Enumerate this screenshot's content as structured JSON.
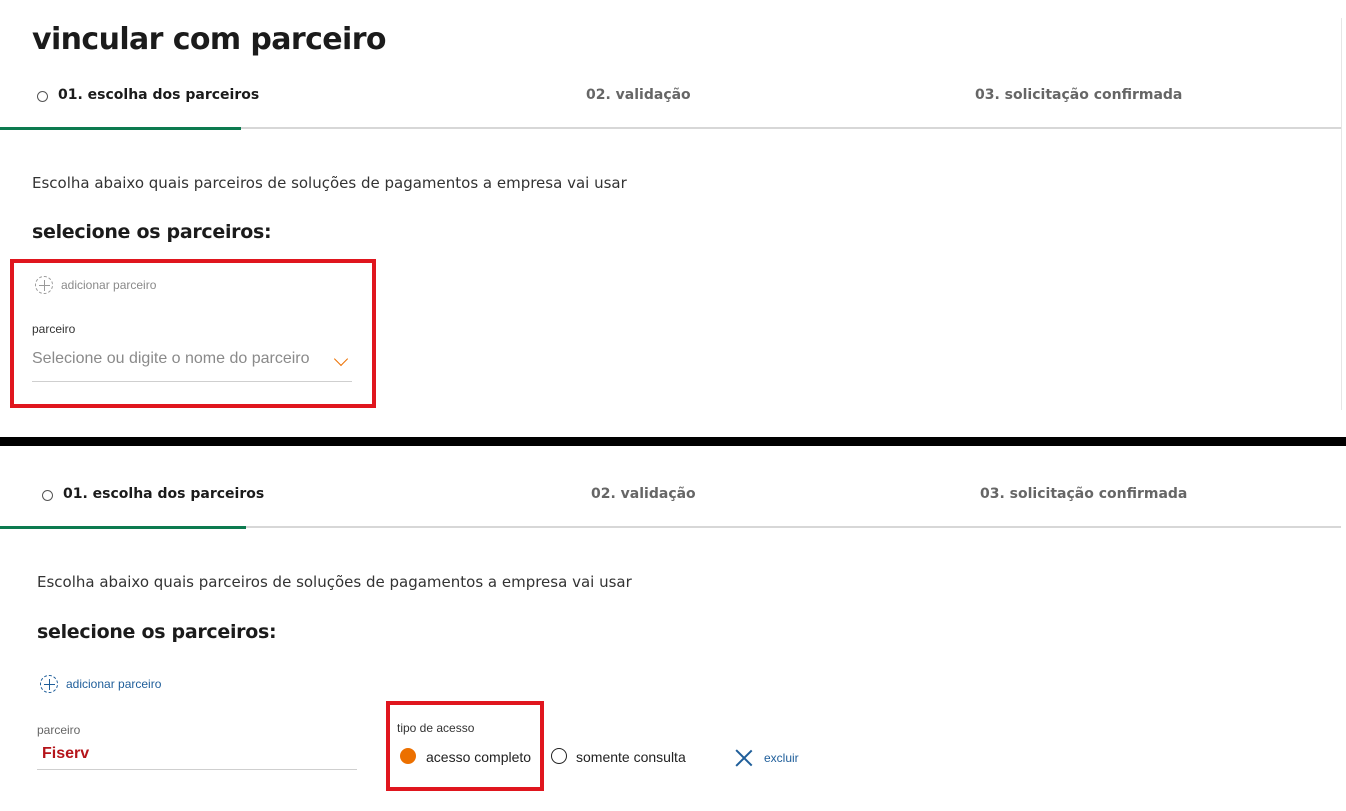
{
  "page_title": "vincular com parceiro",
  "steps": [
    "01. escolha dos parceiros",
    "02. validação",
    "03. solicitação confirmada"
  ],
  "description": "Escolha abaixo quais parceiros de soluções de pagamentos a empresa vai usar",
  "section_heading": "selecione os parceiros:",
  "add_partner_label": "adicionar parceiro",
  "partner_field_label": "parceiro",
  "partner_placeholder": "Selecione ou digite o nome do parceiro",
  "selected_partner": "Fiserv",
  "access_type": {
    "label": "tipo de acesso",
    "options": [
      "acesso completo",
      "somente consulta"
    ],
    "selected": "acesso completo"
  },
  "delete_label": "excluir",
  "colors": {
    "accent_green": "#0c7a4f",
    "accent_orange": "#ec7000",
    "highlight_red": "#e0161e",
    "link_blue": "#1f5e9a",
    "value_red": "#b5141a"
  },
  "icons": [
    "step-dot-icon",
    "add-circle-icon",
    "chevron-down-icon",
    "close-icon"
  ]
}
